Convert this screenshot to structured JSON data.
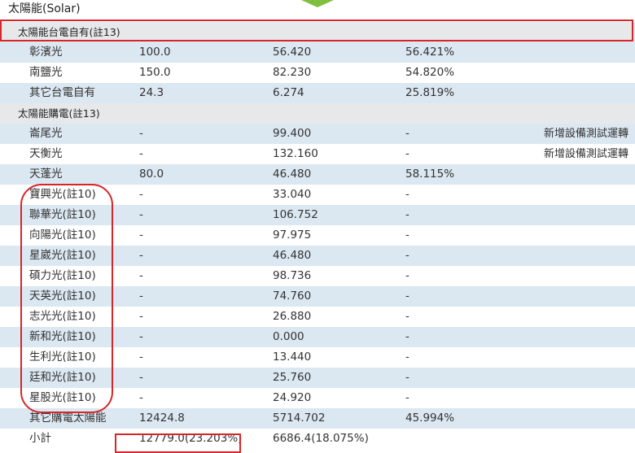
{
  "title": "太陽能(Solar)",
  "sections": [
    {
      "label": "太陽能台電自有(註13)"
    },
    {
      "label": "太陽能購電(註13)"
    }
  ],
  "rows": [
    {
      "name": "彰濱光",
      "capacity": "100.0",
      "generation": "56.420",
      "rate": "56.421%",
      "note": ""
    },
    {
      "name": "南鹽光",
      "capacity": "150.0",
      "generation": "82.230",
      "rate": "54.820%",
      "note": ""
    },
    {
      "name": "其它台電自有",
      "capacity": "24.3",
      "generation": "6.274",
      "rate": "25.819%",
      "note": ""
    },
    {
      "name": "崙尾光",
      "capacity": "-",
      "generation": "99.400",
      "rate": "-",
      "note": "新增設備測試運轉"
    },
    {
      "name": "天衡光",
      "capacity": "-",
      "generation": "132.160",
      "rate": "-",
      "note": "新增設備測試運轉"
    },
    {
      "name": "天蓬光",
      "capacity": "80.0",
      "generation": "46.480",
      "rate": "58.115%",
      "note": ""
    },
    {
      "name": "寶興光(註10)",
      "capacity": "-",
      "generation": "33.040",
      "rate": "-",
      "note": ""
    },
    {
      "name": "聯華光(註10)",
      "capacity": "-",
      "generation": "106.752",
      "rate": "-",
      "note": ""
    },
    {
      "name": "向陽光(註10)",
      "capacity": "-",
      "generation": "97.975",
      "rate": "-",
      "note": ""
    },
    {
      "name": "星崴光(註10)",
      "capacity": "-",
      "generation": "46.480",
      "rate": "-",
      "note": ""
    },
    {
      "name": "碩力光(註10)",
      "capacity": "-",
      "generation": "98.736",
      "rate": "-",
      "note": ""
    },
    {
      "name": "天英光(註10)",
      "capacity": "-",
      "generation": "74.760",
      "rate": "-",
      "note": ""
    },
    {
      "name": "志光光(註10)",
      "capacity": "-",
      "generation": "26.880",
      "rate": "-",
      "note": ""
    },
    {
      "name": "新和光(註10)",
      "capacity": "-",
      "generation": "0.000",
      "rate": "-",
      "note": ""
    },
    {
      "name": "生利光(註10)",
      "capacity": "-",
      "generation": "13.440",
      "rate": "-",
      "note": ""
    },
    {
      "name": "廷和光(註10)",
      "capacity": "-",
      "generation": "25.760",
      "rate": "-",
      "note": ""
    },
    {
      "name": "星股光(註10)",
      "capacity": "-",
      "generation": "24.920",
      "rate": "-",
      "note": ""
    },
    {
      "name": "其它購電太陽能",
      "capacity": "12424.8",
      "generation": "5714.702",
      "rate": "45.994%",
      "note": ""
    }
  ],
  "subtotal": {
    "label": "小計",
    "capacity": "12779.0(23.203%)",
    "generation": "6686.4(18.075%)"
  },
  "colors": {
    "row_blue": "#dbe7f1",
    "section_gray": "#e6e8ea",
    "highlight_red": "#d6262a",
    "arrow_green": "#7fbf3f"
  }
}
